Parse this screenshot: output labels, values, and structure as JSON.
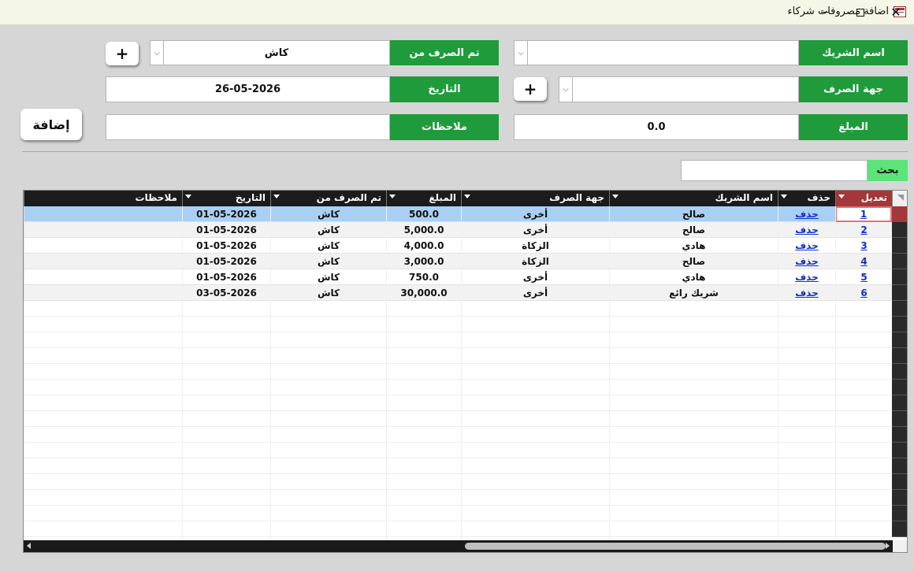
{
  "window": {
    "title": "اضافة مصروفات شركاء",
    "app_icon": "access-form-icon",
    "minimize": "minimize-icon",
    "maximize": "maximize-icon",
    "close": "✕"
  },
  "form": {
    "partner_name_label": "اسم الشريك",
    "partner_name_value": "",
    "paid_from_label": "تم الصرف من",
    "paid_from_value": "كاش",
    "expense_type_label": "جهة الصرف",
    "expense_type_value": "",
    "date_label": "التاريخ",
    "date_value": "26-05-2026",
    "amount_label": "المبلغ",
    "amount_value": "0.0",
    "notes_label": "ملاحظات",
    "notes_value": "",
    "plus_label": "+",
    "add_label": "إضافة",
    "combo_arrow": "⌵"
  },
  "search": {
    "label": "بحث",
    "value": ""
  },
  "grid": {
    "columns": [
      "تعديل",
      "حذف",
      "اسم الشريك",
      "جهة الصرف",
      "المبلغ",
      "تم الصرف من",
      "التاريخ",
      "ملاحظات"
    ],
    "rows": [
      {
        "edit": "1",
        "delete": "حذف",
        "partner": "صالح",
        "type": "أخرى",
        "amount": "500.0",
        "source": "كاش",
        "date": "01-05-2026",
        "notes": ""
      },
      {
        "edit": "2",
        "delete": "حذف",
        "partner": "صالح",
        "type": "أخرى",
        "amount": "5,000.0",
        "source": "كاش",
        "date": "01-05-2026",
        "notes": ""
      },
      {
        "edit": "3",
        "delete": "حذف",
        "partner": "هادي",
        "type": "الزكاة",
        "amount": "4,000.0",
        "source": "كاش",
        "date": "01-05-2026",
        "notes": ""
      },
      {
        "edit": "4",
        "delete": "حذف",
        "partner": "صالح",
        "type": "الزكاة",
        "amount": "3,000.0",
        "source": "كاش",
        "date": "01-05-2026",
        "notes": ""
      },
      {
        "edit": "5",
        "delete": "حذف",
        "partner": "هادي",
        "type": "أخرى",
        "amount": "750.0",
        "source": "كاش",
        "date": "01-05-2026",
        "notes": ""
      },
      {
        "edit": "6",
        "delete": "حذف",
        "partner": "شريك رائع",
        "type": "أخرى",
        "amount": "30,000.0",
        "source": "كاش",
        "date": "03-05-2026",
        "notes": ""
      }
    ]
  },
  "colors": {
    "label_green": "#1f9b3b",
    "search_green": "#5ce37a",
    "selected_row": "#a9d0f2",
    "accent_red": "#a4373a",
    "link_blue": "#1130c8"
  }
}
